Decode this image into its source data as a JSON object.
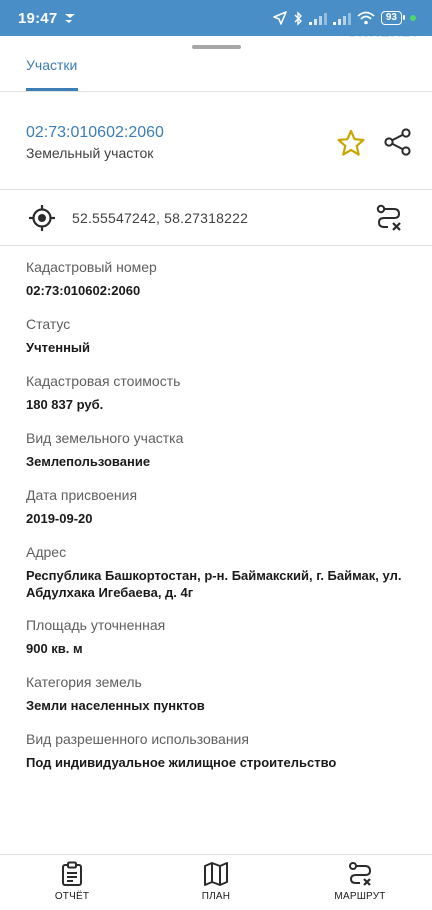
{
  "status_bar": {
    "time": "19:47",
    "battery": "93",
    "watermark": "©NREALT"
  },
  "tabs": [
    {
      "label": "Участки",
      "active": true
    }
  ],
  "header": {
    "cadastral_number": "02:73:010602:2060",
    "object_type": "Земельный участок"
  },
  "coordinates": {
    "text": "52.55547242, 58.27318222"
  },
  "fields": [
    {
      "label": "Кадастровый номер",
      "value": "02:73:010602:2060"
    },
    {
      "label": "Статус",
      "value": "Учтенный"
    },
    {
      "label": "Кадастровая стоимость",
      "value": "180 837 руб."
    },
    {
      "label": "Вид земельного участка",
      "value": "Землепользование"
    },
    {
      "label": "Дата присвоения",
      "value": "2019-09-20"
    },
    {
      "label": "Адрес",
      "value_line1": "Республика Башкортостан, р-н. Баймакский, г. Баймак, ул.",
      "value_line2": "Абдулхака Игебаева, д. 4г"
    },
    {
      "label": "Площадь уточненная",
      "value": "900 кв. м"
    },
    {
      "label": "Категория земель",
      "value": "Земли населенных пунктов"
    },
    {
      "label": "Вид разрешенного использования",
      "value": "Под индивидуальное жилищное строительство"
    }
  ],
  "bottom_nav": [
    {
      "label": "ОТЧЁТ",
      "icon": "clipboard-icon"
    },
    {
      "label": "ПЛАН",
      "icon": "map-icon"
    },
    {
      "label": "МАРШРУТ",
      "icon": "route-icon"
    }
  ],
  "colors": {
    "status_bar": "#4a8ec7",
    "accent": "#3c7db5",
    "star": "#c9a600"
  }
}
